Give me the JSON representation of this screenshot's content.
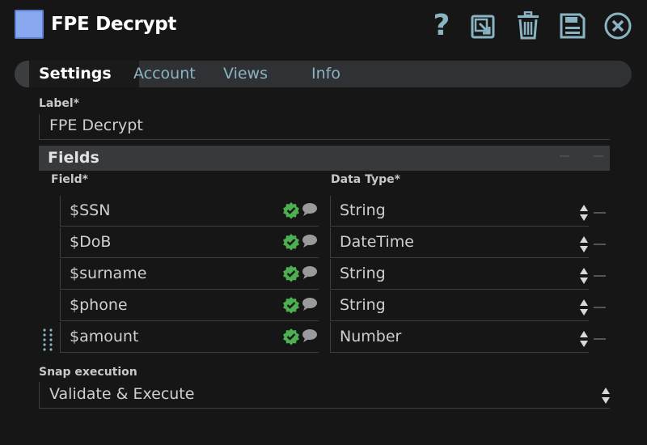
{
  "window": {
    "title": "FPE Decrypt",
    "snap_icon_color": "#8aa8f0",
    "toolbar_icons": [
      "help-icon",
      "export-icon",
      "delete-icon",
      "save-icon",
      "close-icon"
    ],
    "help_glyph": "?"
  },
  "tabs": [
    {
      "label": "Settings",
      "active": true
    },
    {
      "label": "Account",
      "active": false
    },
    {
      "label": "Views",
      "active": false
    },
    {
      "label": "Info",
      "active": false
    }
  ],
  "label_field": {
    "label": "Label*",
    "value": "FPE Decrypt"
  },
  "fields_section": {
    "title": "Fields",
    "col_field": "Field*",
    "col_type": "Data Type*",
    "rows": [
      {
        "field": "$SSN",
        "type": "String"
      },
      {
        "field": "$DoB",
        "type": "DateTime"
      },
      {
        "field": "$surname",
        "type": "String"
      },
      {
        "field": "$phone",
        "type": "String"
      },
      {
        "field": "$amount",
        "type": "Number"
      }
    ]
  },
  "snap_execution": {
    "label": "Snap execution",
    "value": "Validate & Execute"
  },
  "colors": {
    "accent": "#8ab4c2",
    "valid": "#4caf50",
    "background": "#161616"
  }
}
